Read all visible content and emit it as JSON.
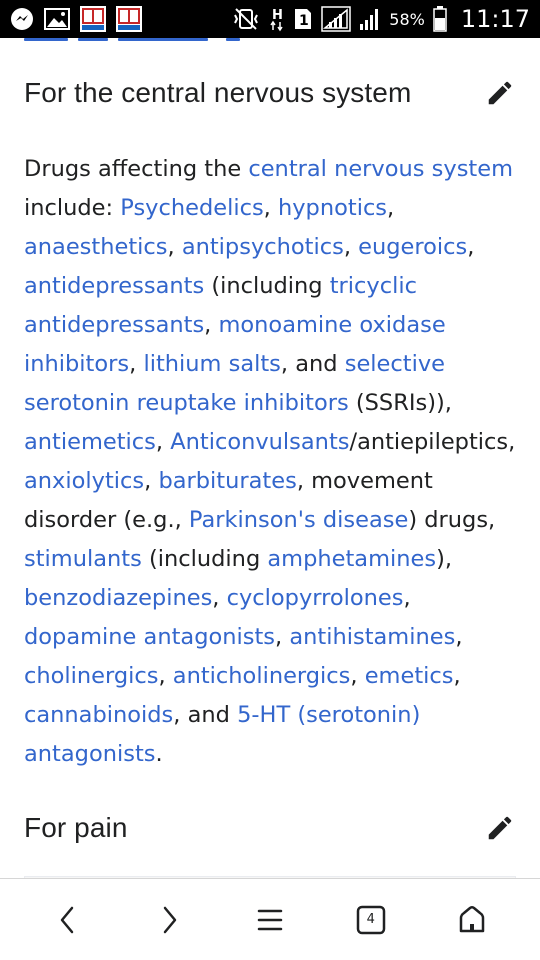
{
  "status_bar": {
    "battery_percent": "58%",
    "time": "11:17",
    "network_type": "H",
    "sim_slot": "1",
    "icons": [
      "messenger-icon",
      "gallery-icon",
      "book-app-icon",
      "book-app-icon",
      "mute-vibrate-icon",
      "network-h-icon",
      "sim-1-icon",
      "signal-icon",
      "signal-icon",
      "battery-icon"
    ]
  },
  "section1": {
    "title": "For the central nervous system",
    "edit_icon": "pencil-icon"
  },
  "paragraph": {
    "t1": "Drugs affecting the ",
    "l1": "central nervous system",
    "t2": " include: ",
    "l2": "Psychedelics",
    "t3": ", ",
    "l3": "hypnotics",
    "t4": ", ",
    "l4": "anaesthetics",
    "t5": ", ",
    "l5": "antipsychotics",
    "t6": ", ",
    "l6": "eugeroics",
    "t7": ", ",
    "l7": "antidepressants",
    "t8": " (including ",
    "l8": "tricyclic antidepressants",
    "t9": ", ",
    "l9": "monoamine oxidase inhibitors",
    "t10": ", ",
    "l10": "lithium salts",
    "t11": ", and ",
    "l11": "selective serotonin reuptake inhibitors",
    "t12": " (SSRIs)), ",
    "l12": "antiemetics",
    "t13": ", ",
    "l13": "Anticonvulsants",
    "t14": "/antiepileptics, ",
    "l14": "anxiolytics",
    "t15": ", ",
    "l15": "barbiturates",
    "t16": ", movement disorder (e.g., ",
    "l16": "Parkinson's disease",
    "t17": ") drugs, ",
    "l17": "stimulants",
    "t18": " (including ",
    "l18": "amphetamines",
    "t19": "), ",
    "l19": "benzodiazepines",
    "t20": ", ",
    "l20": "cyclopyrrolones",
    "t21": ", ",
    "l21": "dopamine antagonists",
    "t22": ", ",
    "l22": "antihistamines",
    "t23": ", ",
    "l23": "cholinergics",
    "t24": ", ",
    "l24": "anticholinergics",
    "t25": ", ",
    "l25": "emetics",
    "t26": ", ",
    "l26": "cannabinoids",
    "t27": ", and ",
    "l27": "5-HT (serotonin) antagonists",
    "t28": "."
  },
  "section2": {
    "title": "For pain",
    "edit_icon": "pencil-icon"
  },
  "bottom_nav": {
    "back_icon": "chevron-left-icon",
    "forward_icon": "chevron-right-icon",
    "menu_icon": "hamburger-menu-icon",
    "tabs_count": "4",
    "home_icon": "home-icon"
  },
  "colors": {
    "link": "#3366cc",
    "text": "#202122",
    "status_bar_bg": "#000000"
  }
}
